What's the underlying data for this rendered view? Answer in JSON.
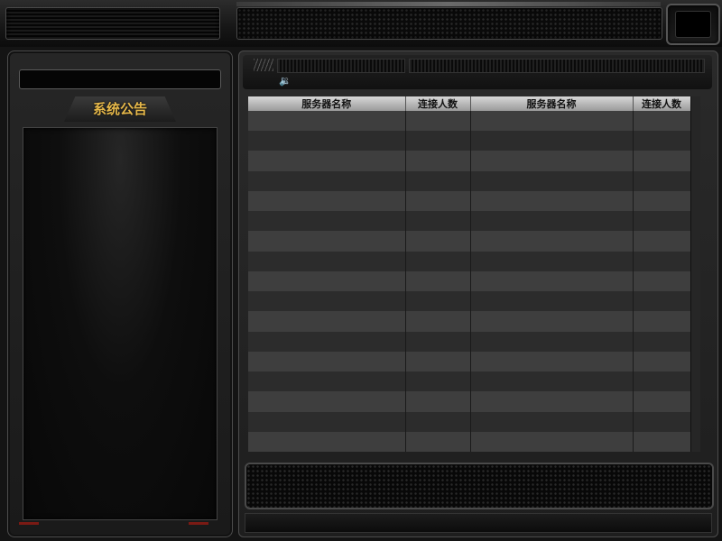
{
  "notice": {
    "title": "系统公告"
  },
  "server_table": {
    "columns": [
      "服务器名称",
      "连接人数",
      "服务器名称",
      "连接人数"
    ],
    "rows": [
      [
        "",
        "",
        "",
        ""
      ],
      [
        "",
        "",
        "",
        ""
      ],
      [
        "",
        "",
        "",
        ""
      ],
      [
        "",
        "",
        "",
        ""
      ],
      [
        "",
        "",
        "",
        ""
      ],
      [
        "",
        "",
        "",
        ""
      ],
      [
        "",
        "",
        "",
        ""
      ],
      [
        "",
        "",
        "",
        ""
      ],
      [
        "",
        "",
        "",
        ""
      ],
      [
        "",
        "",
        "",
        ""
      ],
      [
        "",
        "",
        "",
        ""
      ],
      [
        "",
        "",
        "",
        ""
      ],
      [
        "",
        "",
        "",
        ""
      ],
      [
        "",
        "",
        "",
        ""
      ],
      [
        "",
        "",
        "",
        ""
      ],
      [
        "",
        "",
        "",
        ""
      ],
      [
        "",
        "",
        "",
        ""
      ]
    ]
  },
  "icons": {
    "speaker": "speaker-icon"
  },
  "colors": {
    "accent_gold": "#e6b84a",
    "led_red": "#7a1a14"
  }
}
